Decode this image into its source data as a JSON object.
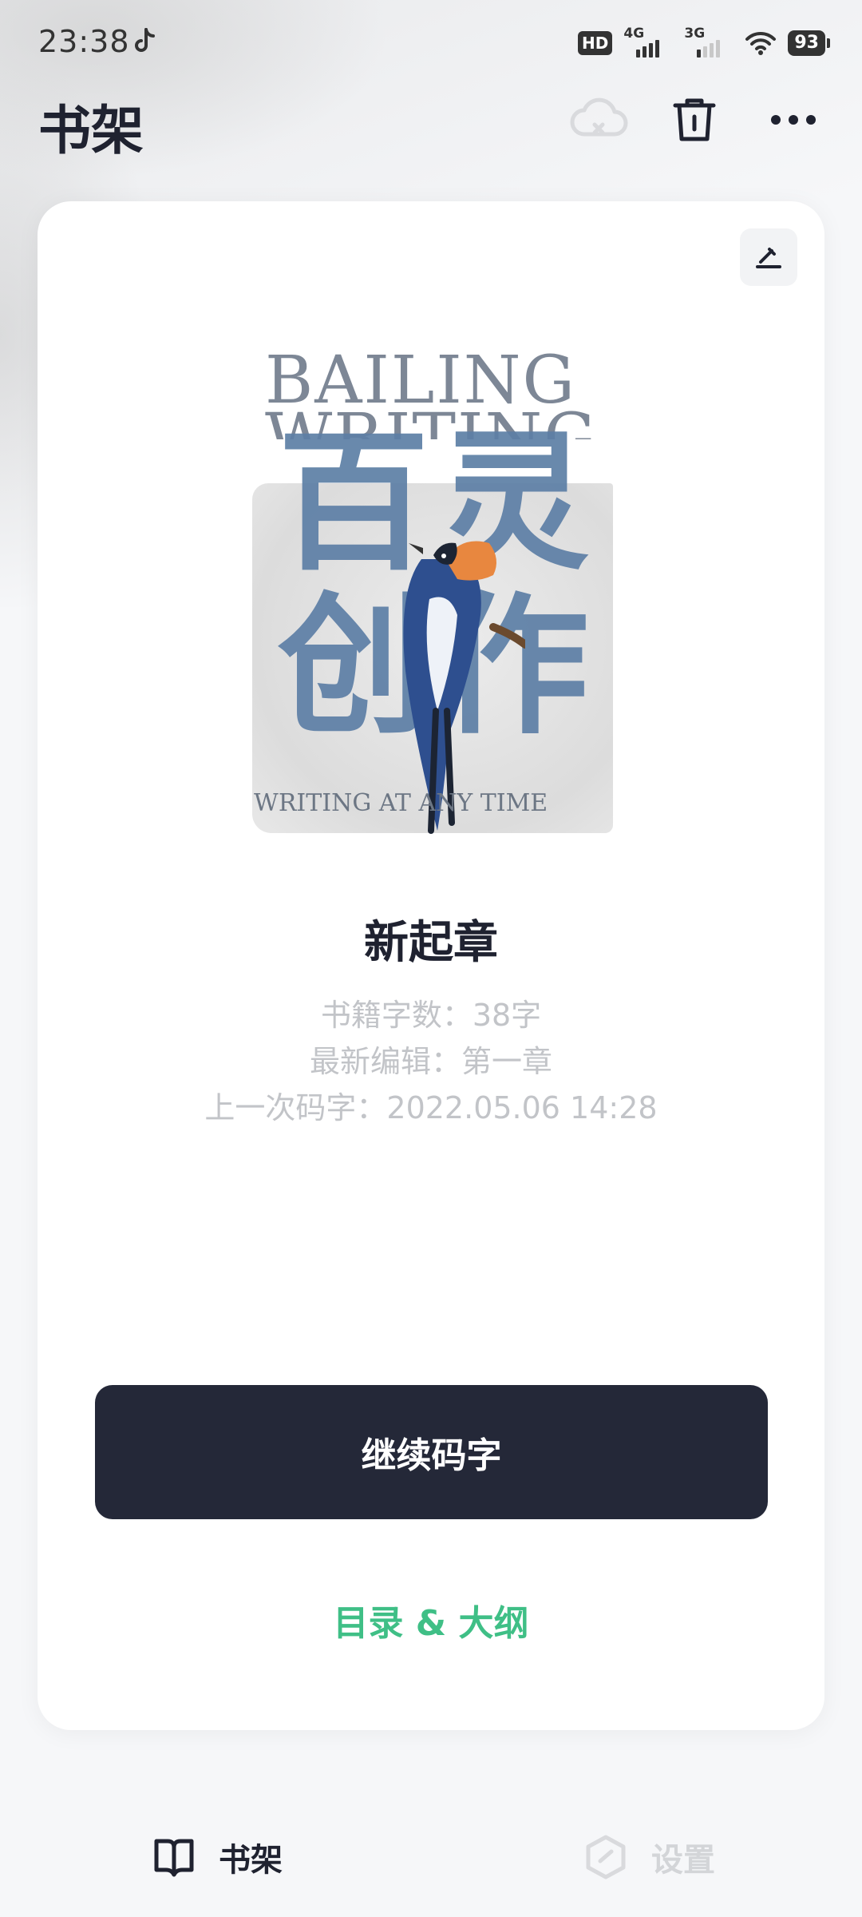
{
  "status_bar": {
    "time": "23:38",
    "hd": "HD",
    "net1": "4G",
    "net2": "3G",
    "battery": "93"
  },
  "header": {
    "title": "书架",
    "icons": [
      "cloud-off-icon",
      "trash-icon",
      "more-icon"
    ]
  },
  "cover": {
    "title_line1": "BAILING",
    "title_line2": "WRITING",
    "cn_line1": "百灵",
    "cn_line2": "创作",
    "subtitle": "WRITING AT ANY TIME"
  },
  "book": {
    "title": "新起章",
    "word_count": "书籍字数：38字",
    "latest_edit": "最新编辑：第一章",
    "last_typed": "上一次码字：2022.05.06 14:28"
  },
  "actions": {
    "continue": "继续码字",
    "toc": "目录 & 大纲"
  },
  "nav": {
    "bookshelf": "书架",
    "settings": "设置"
  },
  "colors": {
    "primary_dark": "#242838",
    "accent_green": "#3fbf86",
    "meta_gray": "#c2c4c8"
  }
}
